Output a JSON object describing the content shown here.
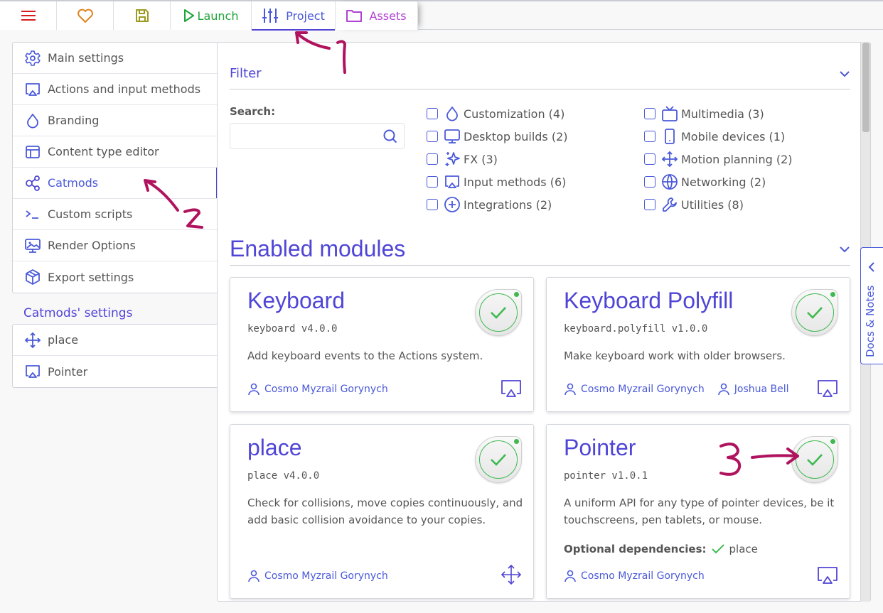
{
  "topbar": {
    "menu_icon": "hamburger-menu-icon",
    "favorite_icon": "heart-icon",
    "save_icon": "floppy-disk-icon",
    "launch_label": "Launch",
    "project_label": "Project",
    "assets_label": "Assets",
    "active_tab": "Project",
    "colors": {
      "menu": "#d81b1b",
      "favorite": "#e0821e",
      "save": "#9a9a1e",
      "launch": "#1fa33a",
      "project": "#4a59d9",
      "assets": "#b043d1"
    }
  },
  "sidebar": {
    "items": [
      {
        "label": "Main settings",
        "icon": "gear-icon"
      },
      {
        "label": "Actions and input methods",
        "icon": "airplay-icon"
      },
      {
        "label": "Branding",
        "icon": "droplet-icon"
      },
      {
        "label": "Content type editor",
        "icon": "layout-icon"
      },
      {
        "label": "Catmods",
        "icon": "share-nodes-icon",
        "active": true
      },
      {
        "label": "Custom scripts",
        "icon": "terminal-icon"
      },
      {
        "label": "Render Options",
        "icon": "monitor-image-icon"
      },
      {
        "label": "Export settings",
        "icon": "package-box-icon"
      }
    ],
    "catmods_settings_title": "Catmods' settings",
    "catmods_settings": [
      {
        "label": "place",
        "icon": "move-arrows-icon"
      },
      {
        "label": "Pointer",
        "icon": "airplay-icon"
      }
    ]
  },
  "filter": {
    "title": "Filter",
    "search_label": "Search:",
    "search_value": "",
    "search_placeholder": "",
    "categories_left": [
      {
        "label": "Customization (4)",
        "icon": "droplet-icon",
        "checked": false
      },
      {
        "label": "Desktop builds (2)",
        "icon": "monitor-icon",
        "checked": false
      },
      {
        "label": "FX (3)",
        "icon": "sparkles-icon",
        "checked": false
      },
      {
        "label": "Input methods (6)",
        "icon": "airplay-icon",
        "checked": false
      },
      {
        "label": "Integrations (2)",
        "icon": "circle-plus-icon",
        "checked": false
      }
    ],
    "categories_right": [
      {
        "label": "Multimedia (3)",
        "icon": "tv-icon",
        "checked": false
      },
      {
        "label": "Mobile devices (1)",
        "icon": "smartphone-icon",
        "checked": false
      },
      {
        "label": "Motion planning (2)",
        "icon": "move-arrows-icon",
        "checked": false
      },
      {
        "label": "Networking (2)",
        "icon": "globe-icon",
        "checked": false
      },
      {
        "label": "Utilities (8)",
        "icon": "wrench-icon",
        "checked": false
      }
    ]
  },
  "modules": {
    "title": "Enabled modules",
    "cards": [
      {
        "name": "Keyboard",
        "version": "keyboard v4.0.0",
        "description": "Add keyboard events to the Actions system.",
        "authors": [
          "Cosmo Myzrail Gorynych"
        ],
        "category_icon": "airplay-icon",
        "enabled": true
      },
      {
        "name": "Keyboard Polyfill",
        "version": "keyboard.polyfill v1.0.0",
        "description": "Make keyboard work with older browsers.",
        "authors": [
          "Cosmo Myzrail Gorynych",
          "Joshua Bell"
        ],
        "category_icon": "airplay-icon",
        "enabled": true
      },
      {
        "name": "place",
        "version": "place v4.0.0",
        "description": "Check for collisions, move copies continuously, and add basic collision avoidance to your copies.",
        "authors": [
          "Cosmo Myzrail Gorynych"
        ],
        "category_icon": "move-arrows-icon",
        "enabled": true
      },
      {
        "name": "Pointer",
        "version": "pointer v1.0.1",
        "description": "A uniform API for any type of pointer devices, be it touchscreens, pen tablets, or mouse.",
        "optional_deps_label": "Optional dependencies:",
        "optional_deps": [
          "place"
        ],
        "authors": [
          "Cosmo Myzrail Gorynych"
        ],
        "category_icon": "airplay-icon",
        "enabled": true
      }
    ]
  },
  "docs_tab": {
    "label": "Docs & Notes"
  },
  "annotations": {
    "one": "1",
    "two": "2",
    "three": "3",
    "color": "#b0135e"
  }
}
